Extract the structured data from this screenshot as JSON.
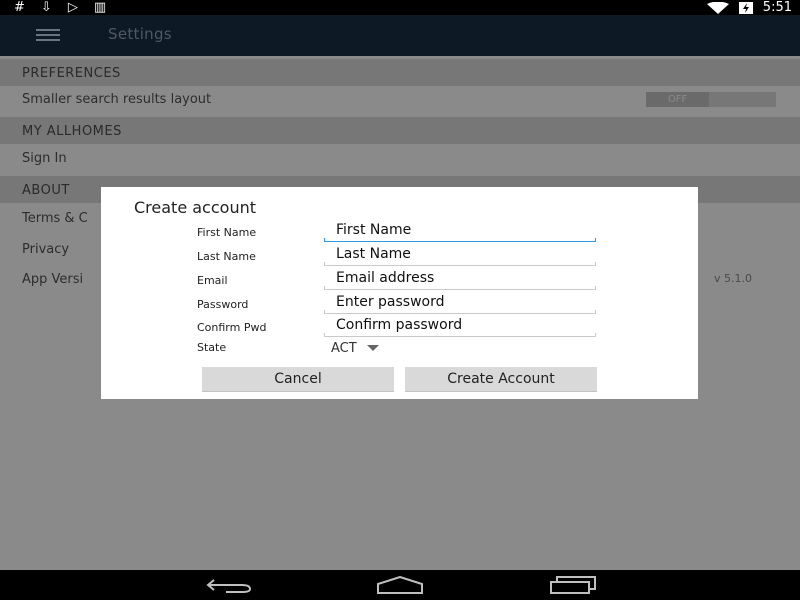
{
  "status_bar": {
    "left_icons": [
      "hash-icon",
      "download-icon",
      "play-store-icon",
      "barcode-icon"
    ],
    "left_glyphs": [
      "#",
      "⇩",
      "▷",
      "▥"
    ],
    "time": "5:51"
  },
  "app_bar": {
    "title": "Settings"
  },
  "settings": {
    "preferences_header": "PREFERENCES",
    "smaller_layout_label": "Smaller search results layout",
    "toggle_value": "OFF",
    "my_allhomes_header": "MY ALLHOMES",
    "sign_in_label": "Sign In",
    "about_header": "ABOUT",
    "terms_label": "Terms & C",
    "privacy_label": "Privacy",
    "app_version_label": "App Versi",
    "app_version_value": "v 5.1.0"
  },
  "dialog": {
    "title": "Create account",
    "fields": [
      {
        "label": "First Name",
        "value": "First Name"
      },
      {
        "label": "Last Name",
        "value": "Last Name"
      },
      {
        "label": "Email",
        "value": "Email address"
      },
      {
        "label": "Password",
        "value": "Enter password"
      },
      {
        "label": "Confirm Pwd",
        "value": "Confirm password"
      }
    ],
    "state_label": "State",
    "state_value": "ACT",
    "cancel_label": "Cancel",
    "create_label": "Create Account"
  },
  "colors": {
    "focus_underline": "#2d9cdb",
    "app_bar": "#0d1a26",
    "dim_overlay": "#8a8a8a"
  }
}
